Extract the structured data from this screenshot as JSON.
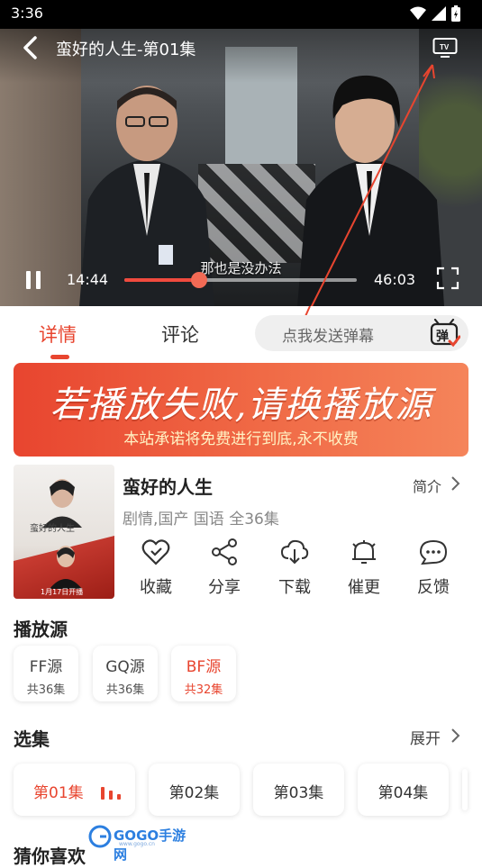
{
  "status_bar": {
    "time": "3:36"
  },
  "player": {
    "title": "蛮好的人生-第01集",
    "subtitle": "那也是没办法",
    "current_time": "14:44",
    "duration": "46:03",
    "progress_fraction": 0.32
  },
  "tabs": {
    "details": "详情",
    "comments": "评论",
    "danmu_placeholder": "点我发送弹幕",
    "danmu_icon_text": "弹"
  },
  "banner": {
    "main": "若播放失败,请换播放源",
    "sub": "本站承诺将免费进行到底,永不收费"
  },
  "show": {
    "title": "蛮好的人生",
    "meta": "剧情,国产 国语 全36集",
    "intro_link": "简介",
    "poster_title": "蛮好的人生",
    "poster_date": "1月17日开播"
  },
  "actions": [
    {
      "label": "收藏",
      "icon": "heart-check-icon"
    },
    {
      "label": "分享",
      "icon": "share-icon"
    },
    {
      "label": "下载",
      "icon": "cloud-download-icon"
    },
    {
      "label": "催更",
      "icon": "bell-icon"
    },
    {
      "label": "反馈",
      "icon": "chat-bubble-icon"
    }
  ],
  "sources": {
    "title": "播放源",
    "items": [
      {
        "name": "FF源",
        "count": "共36集"
      },
      {
        "name": "GQ源",
        "count": "共36集"
      },
      {
        "name": "BF源",
        "count": "共32集"
      }
    ]
  },
  "episodes": {
    "title": "选集",
    "expand": "展开",
    "items": [
      "第01集",
      "第02集",
      "第03集",
      "第04集"
    ]
  },
  "recommend": {
    "title": "猜你喜欢"
  },
  "watermark": {
    "text": "GOGO手游网",
    "url": "www.gogo.cn"
  },
  "colors": {
    "accent": "#e8452f",
    "player_bg": "#2f3235",
    "banner_start": "#e8452f",
    "banner_end": "#f5845a"
  }
}
